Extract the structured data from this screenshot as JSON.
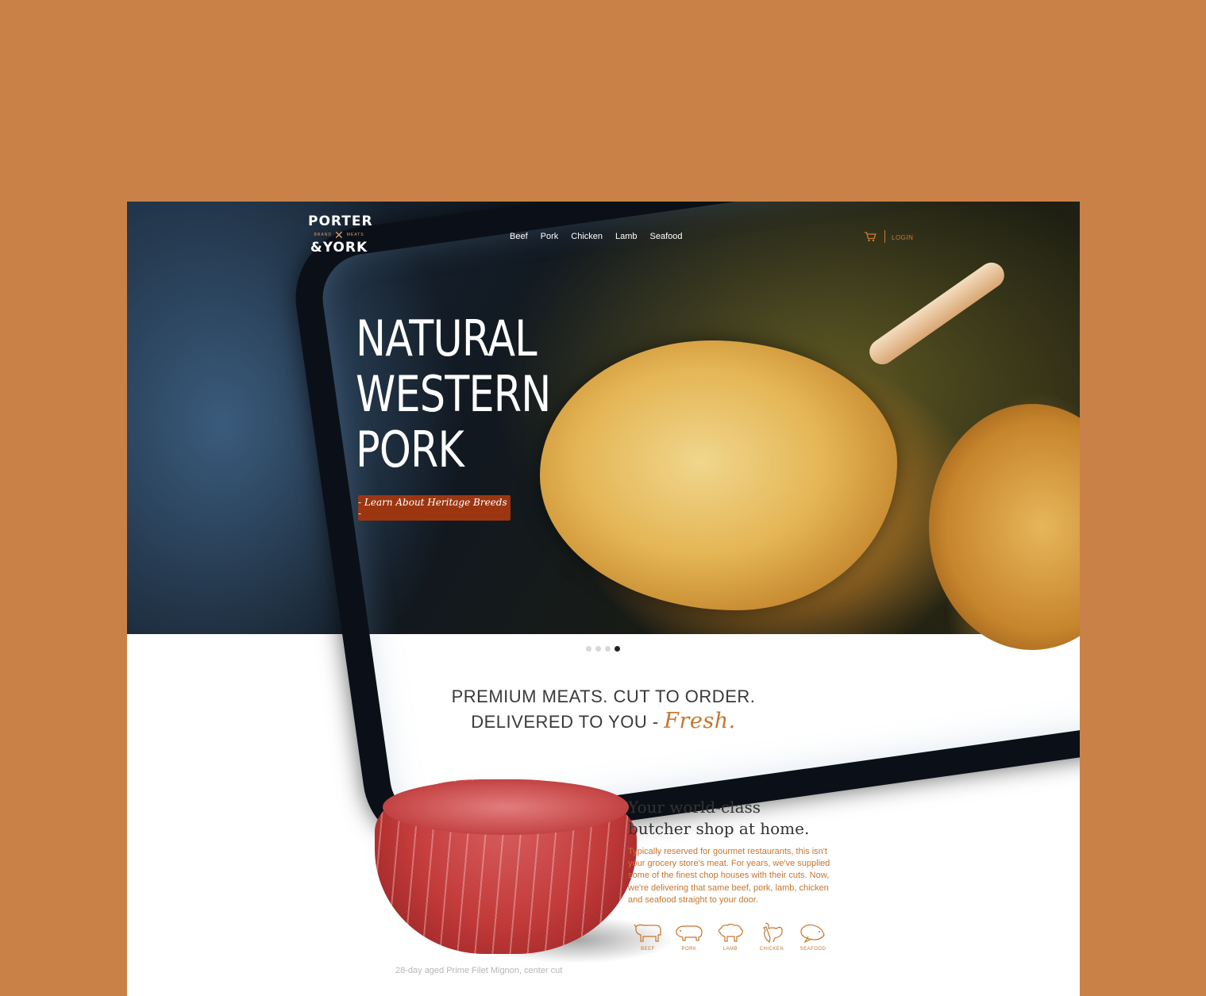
{
  "colors": {
    "page_background": "#c98148",
    "accent": "#c6752d",
    "cta_background": "#9b3611",
    "dot_active": "#222222",
    "dot_inactive": "#d8d8d8"
  },
  "logo": {
    "line1": "PORTER",
    "line2_left": "BRAND",
    "line2_right": "MEATS",
    "line3": "&YORK",
    "icon": "crossed-fork-knife-icon"
  },
  "nav": {
    "items": [
      "Beef",
      "Pork",
      "Chicken",
      "Lamb",
      "Seafood"
    ]
  },
  "account": {
    "cart_icon": "cart-icon",
    "login_label": "LOGIN"
  },
  "hero": {
    "headline_lines": [
      "NATURAL",
      "WESTERN",
      "PORK"
    ],
    "cta_label": "- Learn About Heritage Breeds -"
  },
  "carousel": {
    "dot_count": 4,
    "active_index": 3
  },
  "tagline": {
    "line1": "PREMIUM MEATS. CUT TO ORDER.",
    "line2": "DELIVERED TO YOU -",
    "emphasis": "Fresh."
  },
  "feature": {
    "image_caption": "28-day aged Prime Filet Mignon, center cut",
    "title_line1": "Your world-class",
    "title_line2": "butcher shop at home.",
    "body": "Typically reserved for gourmet restaurants, this isn't your grocery store's meat. For years, we've supplied some of the finest chop houses with their cuts. Now, we're delivering that same beef, pork, lamb, chicken and seafood straight to your door.",
    "categories": [
      {
        "label": "BEEF",
        "icon": "cow-icon"
      },
      {
        "label": "PORK",
        "icon": "pig-icon"
      },
      {
        "label": "LAMB",
        "icon": "sheep-icon"
      },
      {
        "label": "CHICKEN",
        "icon": "chicken-icon"
      },
      {
        "label": "SEAFOOD",
        "icon": "fish-icon"
      }
    ]
  }
}
